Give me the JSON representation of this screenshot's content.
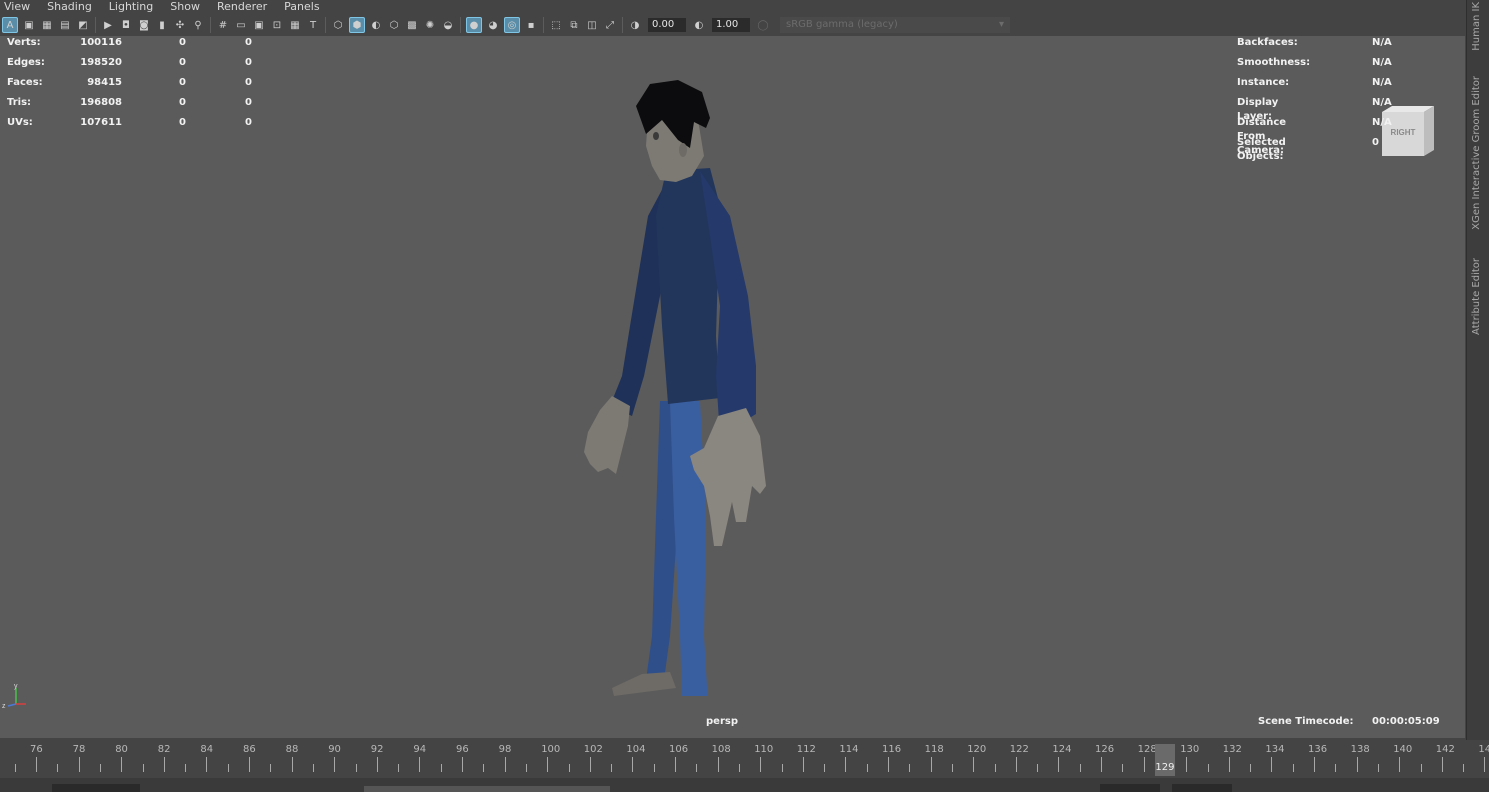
{
  "menu": [
    "View",
    "Shading",
    "Lighting",
    "Show",
    "Renderer",
    "Panels"
  ],
  "toolbar": {
    "exposure_value": "0.00",
    "gamma_value": "1.00",
    "colorspace": "sRGB gamma (legacy)"
  },
  "hud_left": {
    "rows": [
      {
        "label": "Verts:",
        "v1": "100116",
        "v2": "0",
        "v3": "0"
      },
      {
        "label": "Edges:",
        "v1": "198520",
        "v2": "0",
        "v3": "0"
      },
      {
        "label": "Faces:",
        "v1": "98415",
        "v2": "0",
        "v3": "0"
      },
      {
        "label": "Tris:",
        "v1": "196808",
        "v2": "0",
        "v3": "0"
      },
      {
        "label": "UVs:",
        "v1": "107611",
        "v2": "0",
        "v3": "0"
      }
    ]
  },
  "hud_right": {
    "rows": [
      {
        "label": "Backfaces:",
        "value": "N/A"
      },
      {
        "label": "Smoothness:",
        "value": "N/A"
      },
      {
        "label": "Instance:",
        "value": "N/A"
      },
      {
        "label": "Display Layer:",
        "value": "N/A"
      },
      {
        "label": "Distance From Camera:",
        "value": "N/A"
      },
      {
        "label": "Selected Objects:",
        "value": "0"
      }
    ]
  },
  "viewcube_label": "RIGHT",
  "camera_name": "persp",
  "timecode_label": "Scene Timecode:",
  "timecode_value": "00:00:05:09",
  "side_tabs": [
    "Human IK",
    "XGen Interactive Groom Editor",
    "Attribute Editor"
  ],
  "timeline": {
    "labels": [
      "76",
      "78",
      "80",
      "82",
      "84",
      "86",
      "88",
      "90",
      "92",
      "94",
      "96",
      "98",
      "100",
      "102",
      "104",
      "106",
      "108",
      "110",
      "112",
      "114",
      "116",
      "118",
      "120",
      "122",
      "124",
      "126",
      "128",
      "130",
      "132",
      "134",
      "136",
      "138",
      "140",
      "142",
      "14"
    ],
    "current_frame": "129"
  },
  "colors": {
    "viewport_bg": "#5b5b5b",
    "highlight": "#5a8ea8",
    "shirt": "#22365c",
    "pants": "#3a5fa0",
    "skin": "#7d7a74",
    "hair": "#0c0c0e"
  }
}
